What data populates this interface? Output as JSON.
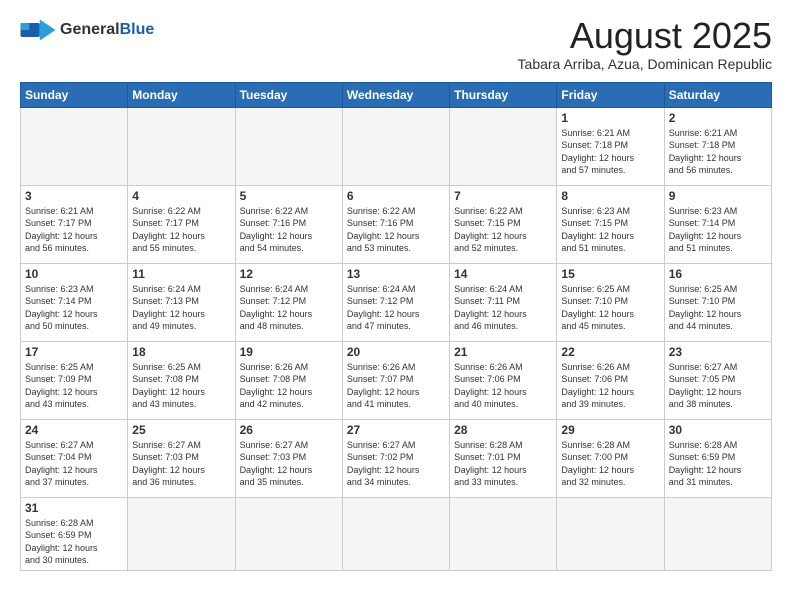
{
  "logo": {
    "text_general": "General",
    "text_blue": "Blue"
  },
  "header": {
    "month_title": "August 2025",
    "location": "Tabara Arriba, Azua, Dominican Republic"
  },
  "weekdays": [
    "Sunday",
    "Monday",
    "Tuesday",
    "Wednesday",
    "Thursday",
    "Friday",
    "Saturday"
  ],
  "weeks": [
    [
      {
        "day": "",
        "info": "",
        "empty": true
      },
      {
        "day": "",
        "info": "",
        "empty": true
      },
      {
        "day": "",
        "info": "",
        "empty": true
      },
      {
        "day": "",
        "info": "",
        "empty": true
      },
      {
        "day": "",
        "info": "",
        "empty": true
      },
      {
        "day": "1",
        "info": "Sunrise: 6:21 AM\nSunset: 7:18 PM\nDaylight: 12 hours\nand 57 minutes."
      },
      {
        "day": "2",
        "info": "Sunrise: 6:21 AM\nSunset: 7:18 PM\nDaylight: 12 hours\nand 56 minutes."
      }
    ],
    [
      {
        "day": "3",
        "info": "Sunrise: 6:21 AM\nSunset: 7:17 PM\nDaylight: 12 hours\nand 56 minutes."
      },
      {
        "day": "4",
        "info": "Sunrise: 6:22 AM\nSunset: 7:17 PM\nDaylight: 12 hours\nand 55 minutes."
      },
      {
        "day": "5",
        "info": "Sunrise: 6:22 AM\nSunset: 7:16 PM\nDaylight: 12 hours\nand 54 minutes."
      },
      {
        "day": "6",
        "info": "Sunrise: 6:22 AM\nSunset: 7:16 PM\nDaylight: 12 hours\nand 53 minutes."
      },
      {
        "day": "7",
        "info": "Sunrise: 6:22 AM\nSunset: 7:15 PM\nDaylight: 12 hours\nand 52 minutes."
      },
      {
        "day": "8",
        "info": "Sunrise: 6:23 AM\nSunset: 7:15 PM\nDaylight: 12 hours\nand 51 minutes."
      },
      {
        "day": "9",
        "info": "Sunrise: 6:23 AM\nSunset: 7:14 PM\nDaylight: 12 hours\nand 51 minutes."
      }
    ],
    [
      {
        "day": "10",
        "info": "Sunrise: 6:23 AM\nSunset: 7:14 PM\nDaylight: 12 hours\nand 50 minutes."
      },
      {
        "day": "11",
        "info": "Sunrise: 6:24 AM\nSunset: 7:13 PM\nDaylight: 12 hours\nand 49 minutes."
      },
      {
        "day": "12",
        "info": "Sunrise: 6:24 AM\nSunset: 7:12 PM\nDaylight: 12 hours\nand 48 minutes."
      },
      {
        "day": "13",
        "info": "Sunrise: 6:24 AM\nSunset: 7:12 PM\nDaylight: 12 hours\nand 47 minutes."
      },
      {
        "day": "14",
        "info": "Sunrise: 6:24 AM\nSunset: 7:11 PM\nDaylight: 12 hours\nand 46 minutes."
      },
      {
        "day": "15",
        "info": "Sunrise: 6:25 AM\nSunset: 7:10 PM\nDaylight: 12 hours\nand 45 minutes."
      },
      {
        "day": "16",
        "info": "Sunrise: 6:25 AM\nSunset: 7:10 PM\nDaylight: 12 hours\nand 44 minutes."
      }
    ],
    [
      {
        "day": "17",
        "info": "Sunrise: 6:25 AM\nSunset: 7:09 PM\nDaylight: 12 hours\nand 43 minutes."
      },
      {
        "day": "18",
        "info": "Sunrise: 6:25 AM\nSunset: 7:08 PM\nDaylight: 12 hours\nand 43 minutes."
      },
      {
        "day": "19",
        "info": "Sunrise: 6:26 AM\nSunset: 7:08 PM\nDaylight: 12 hours\nand 42 minutes."
      },
      {
        "day": "20",
        "info": "Sunrise: 6:26 AM\nSunset: 7:07 PM\nDaylight: 12 hours\nand 41 minutes."
      },
      {
        "day": "21",
        "info": "Sunrise: 6:26 AM\nSunset: 7:06 PM\nDaylight: 12 hours\nand 40 minutes."
      },
      {
        "day": "22",
        "info": "Sunrise: 6:26 AM\nSunset: 7:06 PM\nDaylight: 12 hours\nand 39 minutes."
      },
      {
        "day": "23",
        "info": "Sunrise: 6:27 AM\nSunset: 7:05 PM\nDaylight: 12 hours\nand 38 minutes."
      }
    ],
    [
      {
        "day": "24",
        "info": "Sunrise: 6:27 AM\nSunset: 7:04 PM\nDaylight: 12 hours\nand 37 minutes."
      },
      {
        "day": "25",
        "info": "Sunrise: 6:27 AM\nSunset: 7:03 PM\nDaylight: 12 hours\nand 36 minutes."
      },
      {
        "day": "26",
        "info": "Sunrise: 6:27 AM\nSunset: 7:03 PM\nDaylight: 12 hours\nand 35 minutes."
      },
      {
        "day": "27",
        "info": "Sunrise: 6:27 AM\nSunset: 7:02 PM\nDaylight: 12 hours\nand 34 minutes."
      },
      {
        "day": "28",
        "info": "Sunrise: 6:28 AM\nSunset: 7:01 PM\nDaylight: 12 hours\nand 33 minutes."
      },
      {
        "day": "29",
        "info": "Sunrise: 6:28 AM\nSunset: 7:00 PM\nDaylight: 12 hours\nand 32 minutes."
      },
      {
        "day": "30",
        "info": "Sunrise: 6:28 AM\nSunset: 6:59 PM\nDaylight: 12 hours\nand 31 minutes."
      }
    ],
    [
      {
        "day": "31",
        "info": "Sunrise: 6:28 AM\nSunset: 6:59 PM\nDaylight: 12 hours\nand 30 minutes.",
        "last": true
      },
      {
        "day": "",
        "info": "",
        "empty": true,
        "last": true
      },
      {
        "day": "",
        "info": "",
        "empty": true,
        "last": true
      },
      {
        "day": "",
        "info": "",
        "empty": true,
        "last": true
      },
      {
        "day": "",
        "info": "",
        "empty": true,
        "last": true
      },
      {
        "day": "",
        "info": "",
        "empty": true,
        "last": true
      },
      {
        "day": "",
        "info": "",
        "empty": true,
        "last": true
      }
    ]
  ]
}
